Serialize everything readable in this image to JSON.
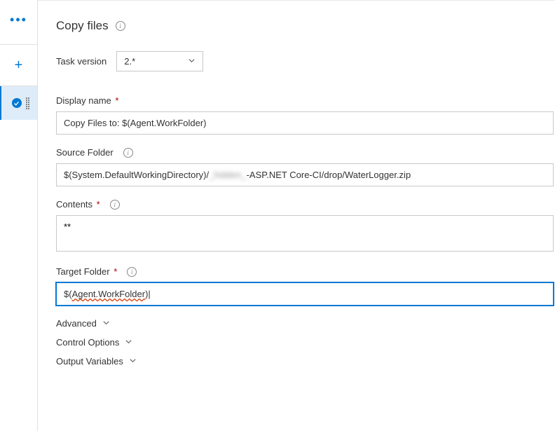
{
  "sidebar": {
    "more": "•••",
    "add": "+"
  },
  "header": {
    "title": "Copy files"
  },
  "task_version": {
    "label": "Task version",
    "value": "2.*"
  },
  "fields": {
    "display_name": {
      "label": "Display name",
      "value": "Copy Files to: $(Agent.WorkFolder)"
    },
    "source_folder": {
      "label": "Source Folder",
      "value_prefix": "$(System.DefaultWorkingDirectory)/",
      "value_hidden": "_hidden_",
      "value_suffix": "-ASP.NET Core-CI/drop/WaterLogger.zip"
    },
    "contents": {
      "label": "Contents",
      "value": "**"
    },
    "target_folder": {
      "label": "Target Folder",
      "value": "$(Agent.WorkFolder)"
    }
  },
  "sections": {
    "advanced": "Advanced",
    "control_options": "Control Options",
    "output_variables": "Output Variables"
  }
}
